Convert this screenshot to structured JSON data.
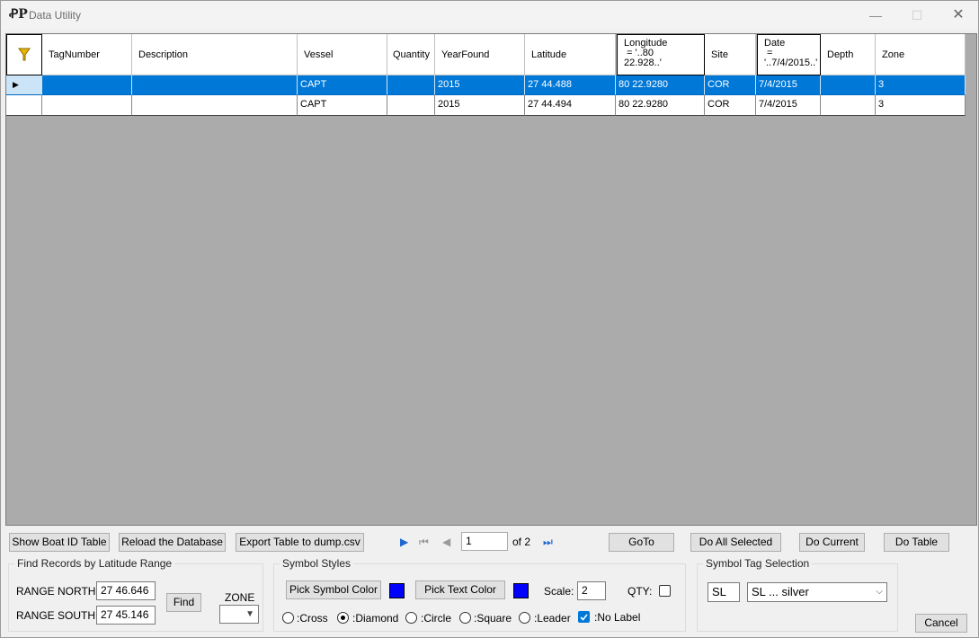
{
  "window": {
    "title": "Data Utility",
    "minimize": "—",
    "maximize": "☐",
    "close": "✕"
  },
  "grid": {
    "filter_icon": "funnel-icon",
    "columns": [
      "TagNumber",
      "Description",
      "Vessel",
      "Quantity",
      "YearFound",
      "Latitude",
      "Longitude\n = '..80\n22.928..'",
      "Site",
      "Date\n =\n'..7/4/2015..'",
      "Depth",
      "Zone"
    ],
    "rows": [
      [
        "",
        "",
        "CAPT",
        "",
        "2015",
        "27 44.488",
        "80 22.9280",
        "COR",
        "7/4/2015",
        "",
        "3"
      ],
      [
        "",
        "",
        "CAPT",
        "",
        "2015",
        "27 44.494",
        "80 22.9280",
        "COR",
        "7/4/2015",
        "",
        "3"
      ]
    ]
  },
  "toolbar": {
    "show_boat_id": "Show Boat ID Table",
    "reload_db": "Reload the Database",
    "export_table": "Export Table to dump.csv",
    "page_value": "1",
    "page_of": "of 2",
    "goto": "GoTo",
    "do_all_selected": "Do All Selected",
    "do_current": "Do Current",
    "do_table": "Do Table"
  },
  "find_records": {
    "title": "Find Records by Latitude Range",
    "north_label": "RANGE NORTH:",
    "north_value": "27 46.646",
    "south_label": "RANGE SOUTH:",
    "south_value": "27 45.146",
    "find": "Find",
    "zone_label": "ZONE",
    "zone_value": ""
  },
  "symbol_styles": {
    "title": "Symbol Styles",
    "pick_symbol_color": "Pick Symbol Color",
    "pick_text_color": "Pick Text Color",
    "symbol_color": "#0000ff",
    "text_color": "#0000ff",
    "scale_label": "Scale:",
    "scale_value": "2",
    "qty_label": "QTY:",
    "qty_checked": false,
    "shapes": [
      {
        "label": ":Cross",
        "selected": false
      },
      {
        "label": ":Diamond",
        "selected": true
      },
      {
        "label": ":Circle",
        "selected": false
      },
      {
        "label": ":Square",
        "selected": false
      },
      {
        "label": ":Leader",
        "selected": false
      }
    ],
    "no_label": ":No Label",
    "no_label_checked": true
  },
  "symbol_tag": {
    "title": "Symbol Tag Selection",
    "code_value": "SL",
    "selected": "SL ... silver"
  },
  "cancel": "Cancel"
}
